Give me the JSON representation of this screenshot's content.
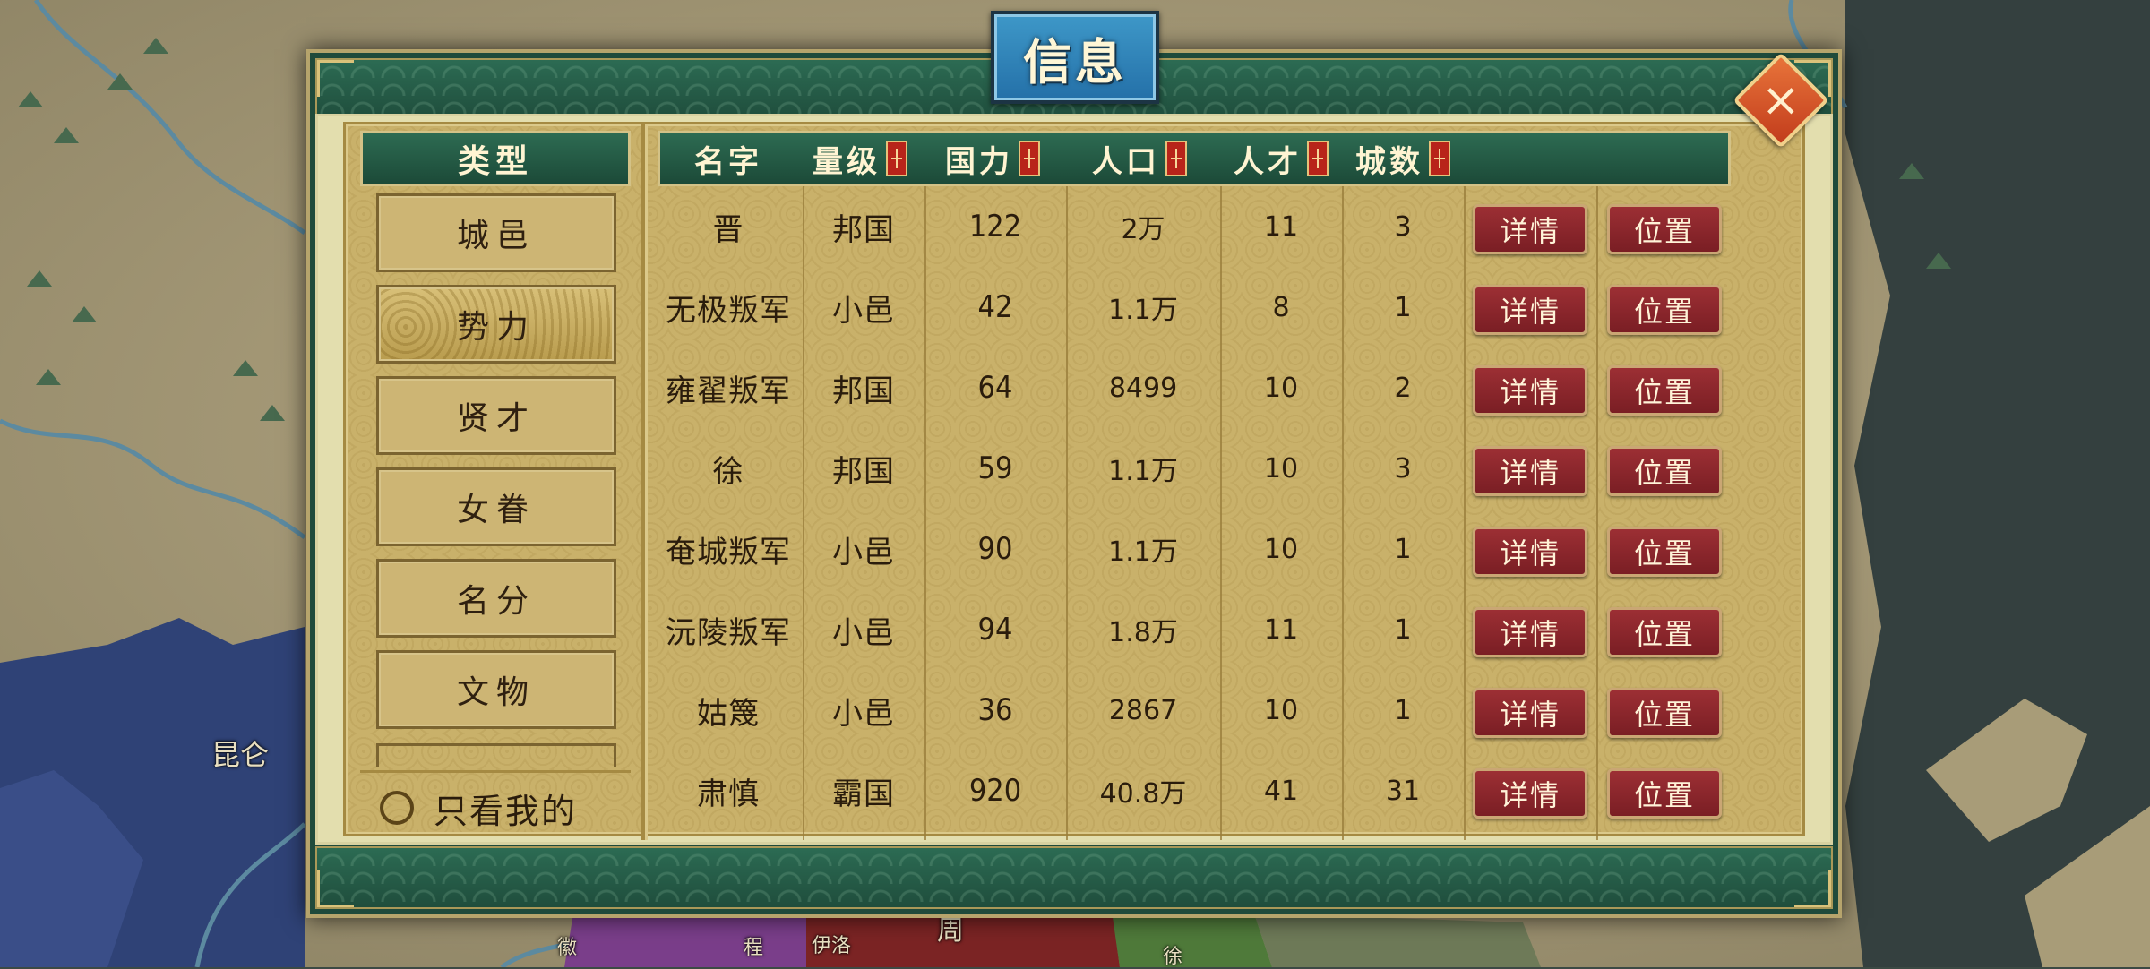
{
  "map": {
    "labels": [
      "昆仑",
      "徽",
      "程",
      "伊洛",
      "周",
      "徐"
    ]
  },
  "dialog": {
    "title": "信息",
    "close_icon": "close-x-icon"
  },
  "sidebar": {
    "header": "类型",
    "categories": [
      "城邑",
      "势力",
      "贤才",
      "女眷",
      "名分",
      "文物"
    ],
    "active_category": "势力",
    "only_mine_label": "只看我的"
  },
  "table": {
    "headers": {
      "name": "名字",
      "level": "量级",
      "power": "国力",
      "population": "人口",
      "talent": "人才",
      "cities": "城数"
    },
    "detail_label": "详情",
    "location_label": "位置",
    "rows": [
      {
        "name": "晋",
        "level": "邦国",
        "power": "122",
        "population": "2万",
        "talent": "11",
        "cities": "3"
      },
      {
        "name": "无极叛军",
        "level": "小邑",
        "power": "42",
        "population": "1.1万",
        "talent": "8",
        "cities": "1"
      },
      {
        "name": "雍翟叛军",
        "level": "邦国",
        "power": "64",
        "population": "8499",
        "talent": "10",
        "cities": "2"
      },
      {
        "name": "徐",
        "level": "邦国",
        "power": "59",
        "population": "1.1万",
        "talent": "10",
        "cities": "3"
      },
      {
        "name": "奄城叛军",
        "level": "小邑",
        "power": "90",
        "population": "1.1万",
        "talent": "10",
        "cities": "1"
      },
      {
        "name": "沅陵叛军",
        "level": "小邑",
        "power": "94",
        "population": "1.8万",
        "talent": "11",
        "cities": "1"
      },
      {
        "name": "姑篾",
        "level": "小邑",
        "power": "36",
        "population": "2867",
        "talent": "10",
        "cities": "1"
      },
      {
        "name": "肃慎",
        "level": "霸国",
        "power": "920",
        "population": "40.8万",
        "talent": "41",
        "cities": "31"
      }
    ]
  }
}
